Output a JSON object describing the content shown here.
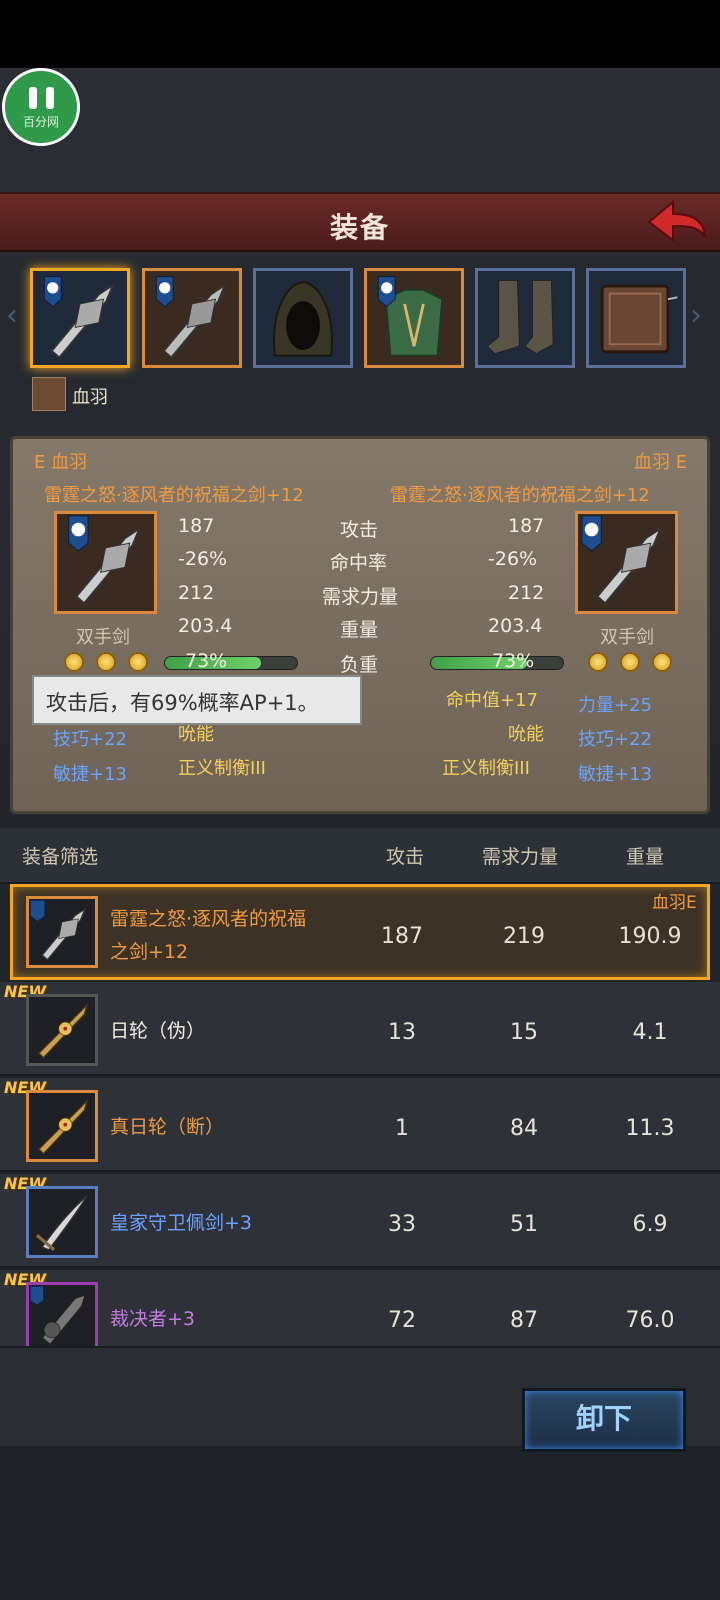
{
  "header": {
    "title": "装备"
  },
  "pause": {
    "watermark": "百分网"
  },
  "hero": {
    "name": "血羽"
  },
  "compare": {
    "left_tag": "E 血羽",
    "right_tag": "血羽 E",
    "left_item": "雷霆之怒·逐风者的祝福之剑+12",
    "right_item": "雷霆之怒·逐风者的祝福之剑+12",
    "left_type": "双手剑",
    "right_type": "双手剑",
    "stats": [
      {
        "label": "攻击",
        "left": "187",
        "right": "187"
      },
      {
        "label": "命中率",
        "left": "-26%",
        "right": "-26%"
      },
      {
        "label": "需求力量",
        "left": "212",
        "right": "212"
      },
      {
        "label": "重量",
        "left": "203.4",
        "right": "203.4"
      },
      {
        "label": "负重",
        "left": "73%",
        "right": "73%"
      }
    ],
    "left_bonus": [
      "技巧+22",
      "敏捷+13"
    ],
    "left_skills": [
      "吮能",
      "正义制衡III"
    ],
    "right_skills": [
      "命中值+17",
      "吮能",
      "正义制衡III"
    ],
    "right_bonus": [
      "力量+25",
      "技巧+22",
      "敏捷+13"
    ],
    "tooltip": "攻击后，有69%概率AP+1。",
    "load_fill": 0.73
  },
  "filter": {
    "label": "装备筛选",
    "col_attack": "攻击",
    "col_str": "需求力量",
    "col_weight": "重量"
  },
  "items": [
    {
      "name1": "雷霆之怒·逐风者的祝福",
      "name2": "之剑+12",
      "attack": "187",
      "str": "219",
      "weight": "190.9",
      "badge": "血羽E"
    },
    {
      "name": "日轮（伪）",
      "attack": "13",
      "str": "15",
      "weight": "4.1",
      "new": "NEW"
    },
    {
      "name": "真日轮（断）",
      "attack": "1",
      "str": "84",
      "weight": "11.3",
      "new": "NEW"
    },
    {
      "name": "皇家守卫佩剑+3",
      "attack": "33",
      "str": "51",
      "weight": "6.9",
      "new": "NEW"
    },
    {
      "name": "裁决者+3",
      "attack": "72",
      "str": "87",
      "weight": "76.0",
      "new": "NEW"
    }
  ],
  "unequip": "卸下"
}
